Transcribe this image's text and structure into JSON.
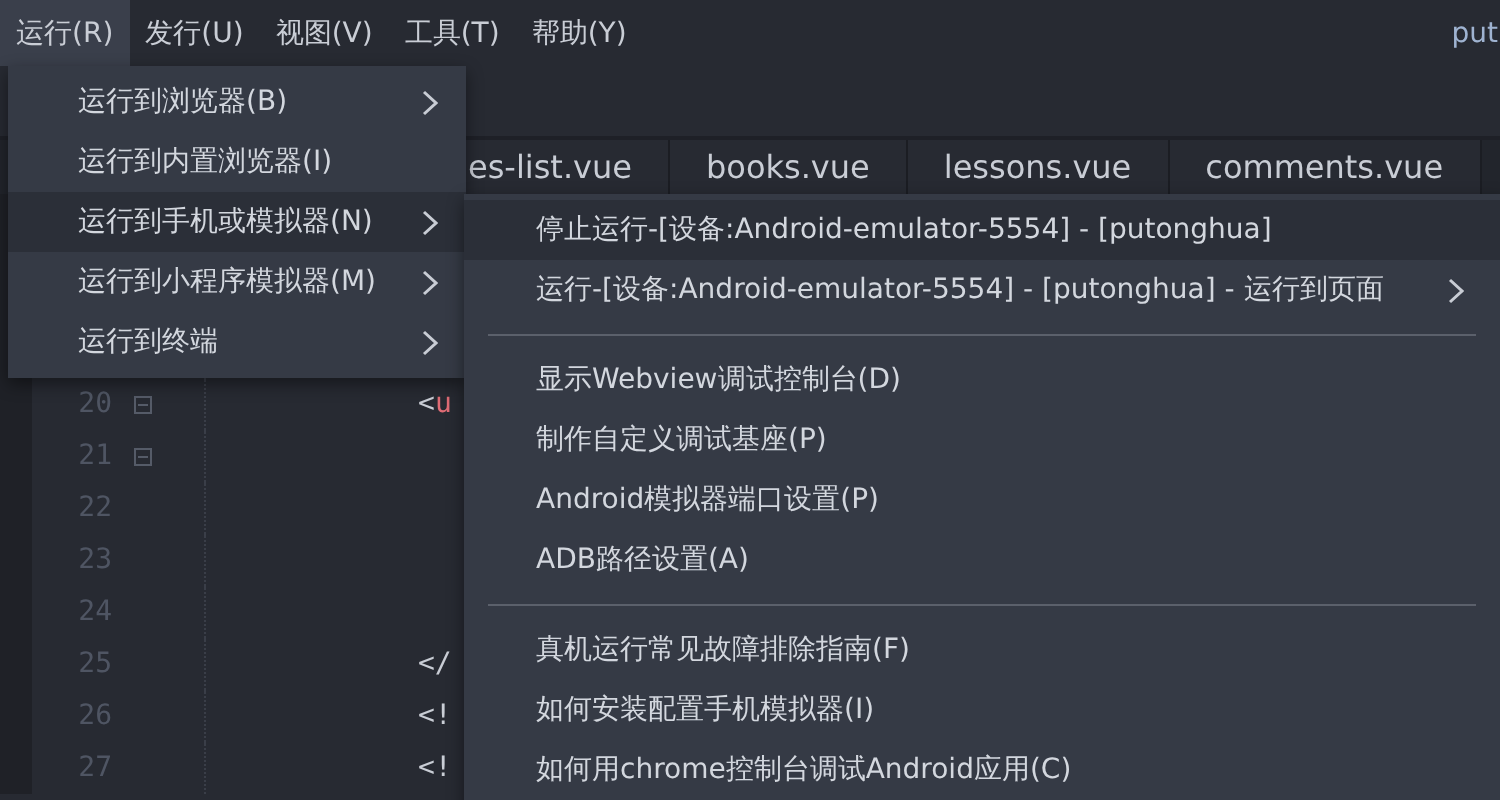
{
  "menubar": {
    "items": [
      {
        "label": "运行(R)",
        "selected": true
      },
      {
        "label": "发行(U)",
        "selected": false
      },
      {
        "label": "视图(V)",
        "selected": false
      },
      {
        "label": "工具(T)",
        "selected": false
      },
      {
        "label": "帮助(Y)",
        "selected": false
      }
    ],
    "title": "put"
  },
  "tabs": [
    {
      "label": "es-list.vue"
    },
    {
      "label": "books.vue"
    },
    {
      "label": "lessons.vue"
    },
    {
      "label": "comments.vue"
    }
  ],
  "editor": {
    "lines": [
      {
        "number": "20",
        "foldable": true,
        "code": [
          {
            "text": "<",
            "kind": "punct"
          },
          {
            "text": "u",
            "kind": "tag"
          }
        ]
      },
      {
        "number": "21",
        "foldable": true
      },
      {
        "number": "22",
        "foldable": false
      },
      {
        "number": "23",
        "foldable": false
      },
      {
        "number": "24",
        "foldable": false
      },
      {
        "number": "25",
        "foldable": false,
        "code": [
          {
            "text": "</",
            "kind": "punct"
          }
        ]
      },
      {
        "number": "26",
        "foldable": false,
        "code": [
          {
            "text": "<!",
            "kind": "punct"
          }
        ]
      },
      {
        "number": "27",
        "foldable": false,
        "code": [
          {
            "text": "<!",
            "kind": "punct"
          }
        ]
      }
    ]
  },
  "run_menu": {
    "items": [
      {
        "label": "运行到浏览器(B)",
        "selected": false,
        "has_submenu": true
      },
      {
        "label": "运行到内置浏览器(I)",
        "selected": false,
        "has_submenu": false
      },
      {
        "label": "运行到手机或模拟器(N)",
        "selected": true,
        "has_submenu": true
      },
      {
        "label": "运行到小程序模拟器(M)",
        "selected": false,
        "has_submenu": true
      },
      {
        "label": "运行到终端",
        "selected": false,
        "has_submenu": true
      }
    ]
  },
  "device_submenu": {
    "groups": [
      {
        "items": [
          {
            "label": "停止运行-[设备:Android-emulator-5554] - [putonghua]",
            "selected": true,
            "has_submenu": false
          },
          {
            "label": "运行-[设备:Android-emulator-5554] - [putonghua] - 运行到页面",
            "selected": false,
            "has_submenu": true
          }
        ]
      },
      {
        "items": [
          {
            "label": "显示Webview调试控制台(D)",
            "selected": false,
            "has_submenu": false
          },
          {
            "label": "制作自定义调试基座(P)",
            "selected": false,
            "has_submenu": false
          },
          {
            "label": "Android模拟器端口设置(P)",
            "selected": false,
            "has_submenu": false
          },
          {
            "label": "ADB路径设置(A)",
            "selected": false,
            "has_submenu": false
          }
        ]
      },
      {
        "items": [
          {
            "label": "真机运行常见故障排除指南(F)",
            "selected": false,
            "has_submenu": false
          },
          {
            "label": "如何安装配置手机模拟器(I)",
            "selected": false,
            "has_submenu": false
          },
          {
            "label": "如何用chrome控制台调试Android应用(C)",
            "selected": false,
            "has_submenu": false
          }
        ]
      }
    ]
  }
}
